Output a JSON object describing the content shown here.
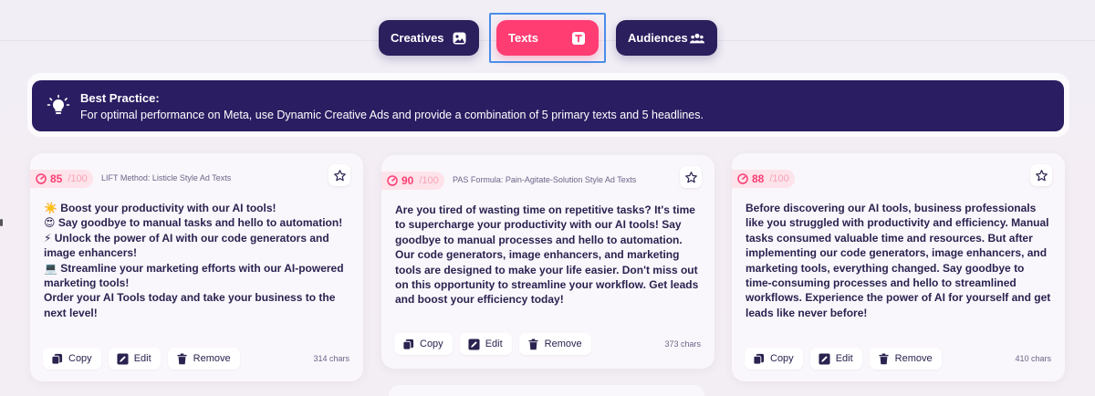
{
  "tabs": [
    {
      "label": "Creatives",
      "icon": "image-icon",
      "active": false
    },
    {
      "label": "Texts",
      "icon": "text-icon",
      "active": true
    },
    {
      "label": "Audiences",
      "icon": "people-icon",
      "active": false
    }
  ],
  "banner": {
    "title": "Best Practice:",
    "text": "For optimal performance on Meta, use Dynamic Creative Ads and provide a combination of 5 primary texts and 5 headlines.",
    "icon": "lightbulb-icon"
  },
  "colors": {
    "accent": "#ff3d73",
    "primary": "#2c1f5e",
    "focus": "#4a8de8"
  },
  "actions": {
    "copy": "Copy",
    "edit": "Edit",
    "remove": "Remove"
  },
  "cards": [
    {
      "score": "85",
      "score_max": "/100",
      "method": "LIFT Method: Listicle Style Ad Texts",
      "lines": [
        "☀️ Boost your productivity with our AI tools!",
        "😍 Say goodbye to manual tasks and hello to automation!",
        "⚡ Unlock the power of AI with our code generators and image enhancers!",
        "💻 Streamline your marketing efforts with our AI-powered marketing tools!",
        "Order your AI Tools today and take your business to the next level!"
      ],
      "chars": "314 chars"
    },
    {
      "score": "90",
      "score_max": "/100",
      "method": "PAS Formula: Pain-Agitate-Solution Style Ad Texts",
      "lines": [
        "Are you tired of wasting time on repetitive tasks? It's time to supercharge your productivity with our AI tools! Say goodbye to manual processes and hello to automation. Our code generators, image enhancers, and marketing tools are designed to make your life easier. Don't miss out on this opportunity to streamline your workflow. Get leads and boost your efficiency today!"
      ],
      "chars": "373 chars"
    },
    {
      "score": "88",
      "score_max": "/100",
      "method": "",
      "lines": [
        "Before discovering our AI tools, business professionals like you struggled with productivity and efficiency. Manual tasks consumed valuable time and resources. But after implementing our code generators, image enhancers, and marketing tools, everything changed. Say goodbye to time-consuming processes and hello to streamlined workflows. Experience the power of AI for yourself and get leads like never before!"
      ],
      "chars": "410 chars"
    }
  ]
}
